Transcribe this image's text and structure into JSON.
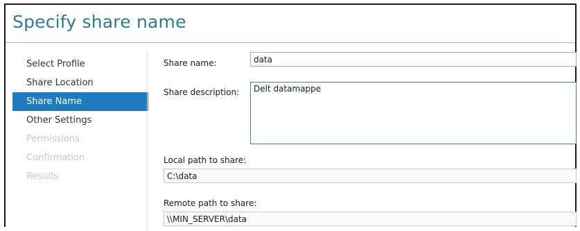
{
  "wizard": {
    "title": "Specify share name"
  },
  "nav": {
    "items": [
      {
        "label": "Select Profile",
        "state": "normal"
      },
      {
        "label": "Share Location",
        "state": "normal"
      },
      {
        "label": "Share Name",
        "state": "active"
      },
      {
        "label": "Other Settings",
        "state": "normal"
      },
      {
        "label": "Permissions",
        "state": "disabled"
      },
      {
        "label": "Confirmation",
        "state": "disabled"
      },
      {
        "label": "Results",
        "state": "disabled"
      }
    ]
  },
  "form": {
    "share_name_label": "Share name:",
    "share_name_value": "data",
    "share_description_label": "Share description:",
    "share_description_value": "Delt datamappe",
    "local_path_label": "Local path to share:",
    "local_path_value": "C:\\data",
    "remote_path_label": "Remote path to share:",
    "remote_path_value": "\\\\MIN_SERVER\\data"
  },
  "colors": {
    "title": "#2e7a9c",
    "active_nav_bg": "#1e7bc2",
    "disabled_nav_text": "#c8c8c8"
  }
}
